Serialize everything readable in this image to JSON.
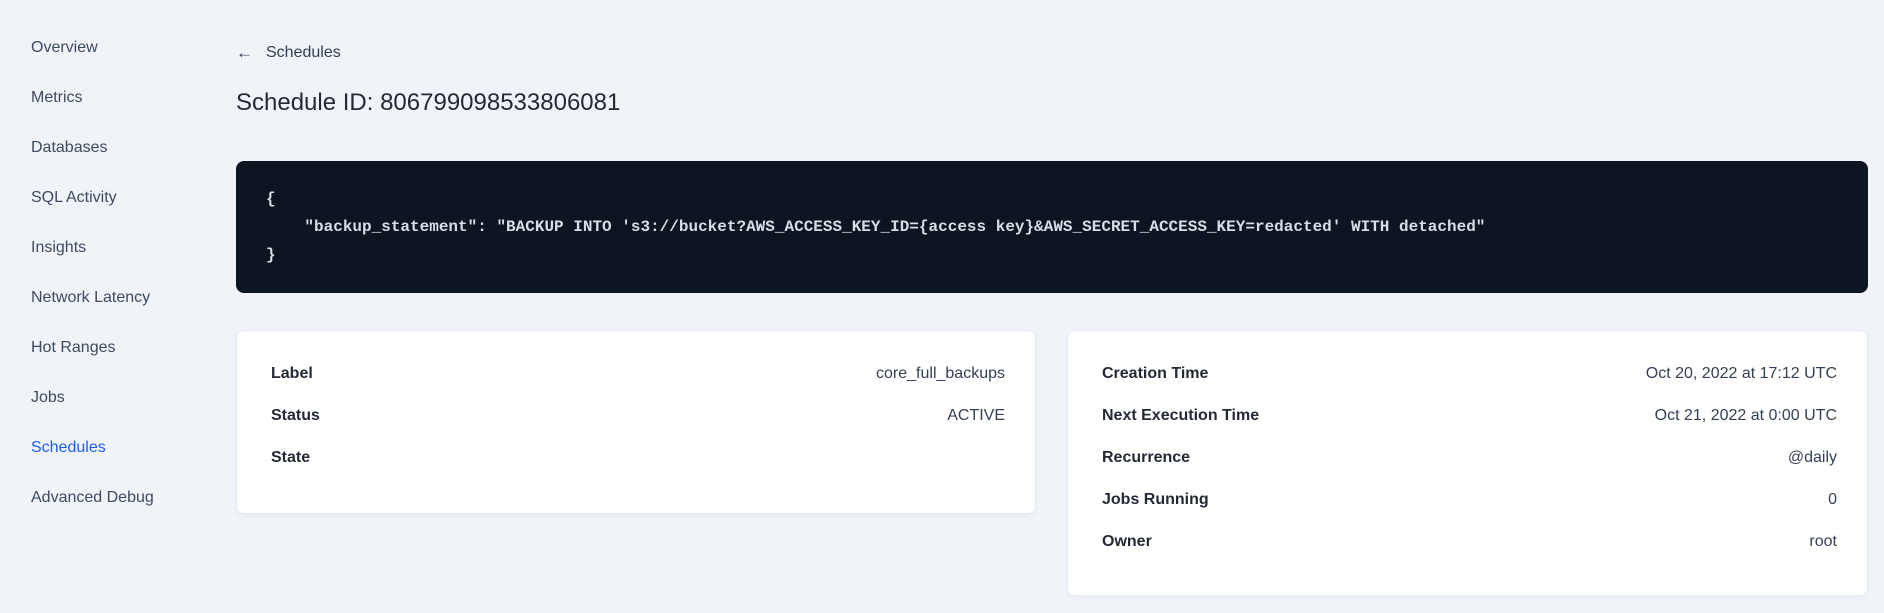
{
  "colors": {
    "background": "#f0f4f8",
    "card_background": "#ffffff",
    "card_border": "#e7ecf3",
    "code_background": "#0e1522",
    "code_text": "#d8dde6",
    "accent_blue": "#1c5cf0",
    "text_dark": "#242a35",
    "text_slate": "#3e4a61"
  },
  "icons": {
    "back_arrow": "←"
  },
  "sidebar": {
    "items": [
      {
        "label": "Overview"
      },
      {
        "label": "Metrics"
      },
      {
        "label": "Databases"
      },
      {
        "label": "SQL Activity"
      },
      {
        "label": "Insights"
      },
      {
        "label": "Network Latency"
      },
      {
        "label": "Hot Ranges"
      },
      {
        "label": "Jobs"
      },
      {
        "label": "Schedules",
        "active": true
      },
      {
        "label": "Advanced Debug"
      }
    ]
  },
  "header": {
    "back_label": "Schedules",
    "title": "Schedule ID: 806799098533806081"
  },
  "code_block": {
    "lines": [
      "{",
      "    \"backup_statement\": \"BACKUP INTO 's3://bucket?AWS_ACCESS_KEY_ID={access key}&AWS_SECRET_ACCESS_KEY=redacted' WITH detached\"",
      "}"
    ]
  },
  "cards": {
    "details": {
      "rows": [
        {
          "label": "Label",
          "value": "core_full_backups"
        },
        {
          "label": "Status",
          "value": "ACTIVE"
        },
        {
          "label": "State",
          "value": ""
        }
      ]
    },
    "schedule": {
      "rows": [
        {
          "label": "Creation Time",
          "value": "Oct 20, 2022 at 17:12 UTC"
        },
        {
          "label": "Next Execution Time",
          "value": "Oct 21, 2022 at 0:00 UTC"
        },
        {
          "label": "Recurrence",
          "value": "@daily"
        },
        {
          "label": "Jobs Running",
          "value": "0"
        },
        {
          "label": "Owner",
          "value": "root"
        }
      ]
    }
  }
}
